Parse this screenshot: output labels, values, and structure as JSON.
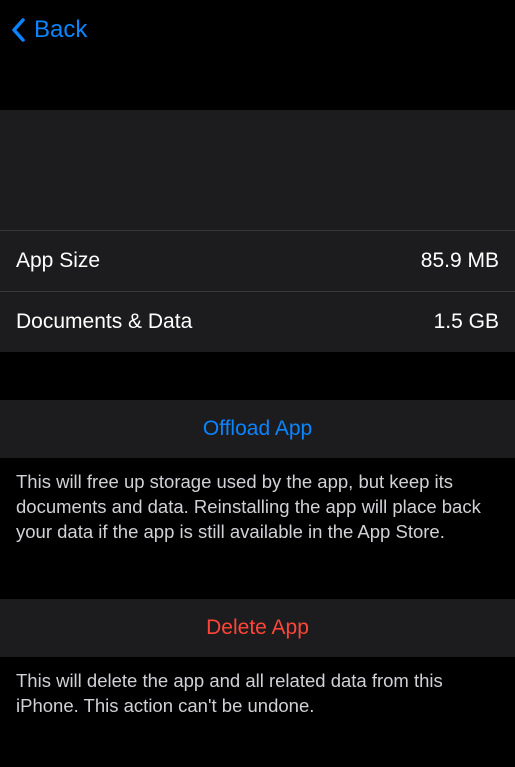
{
  "nav": {
    "back_label": "Back"
  },
  "storage": {
    "app_size": {
      "label": "App Size",
      "value": "85.9 MB"
    },
    "documents_data": {
      "label": "Documents & Data",
      "value": "1.5 GB"
    }
  },
  "actions": {
    "offload": {
      "label": "Offload App",
      "description": "This will free up storage used by the app, but keep its documents and data. Reinstalling the app will place back your data if the app is still available in the App Store."
    },
    "delete": {
      "label": "Delete App",
      "description": "This will delete the app and all related data from this iPhone. This action can't be undone."
    }
  },
  "colors": {
    "accent": "#0a84ff",
    "destructive": "#ff453a",
    "background": "#000000",
    "cell_background": "#1c1c1e"
  }
}
